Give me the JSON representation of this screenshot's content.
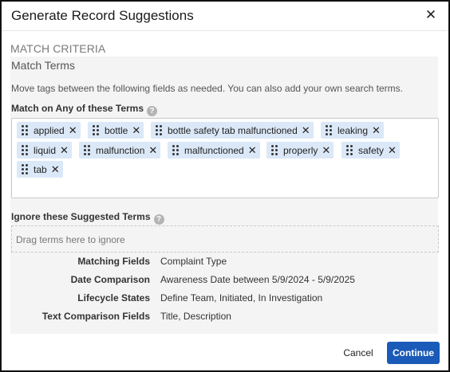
{
  "dialog": {
    "title": "Generate Record Suggestions",
    "close_icon": "close-icon"
  },
  "section": {
    "heading": "MATCH CRITERIA",
    "panel_title": "Match Terms",
    "description": "Move tags between the following fields as needed. You can also add your own search terms."
  },
  "match_terms": {
    "label": "Match on Any of these Terms",
    "help_glyph": "?",
    "tags": [
      "applied",
      "bottle",
      "bottle safety tab malfunctioned",
      "leaking",
      "liquid",
      "malfunction",
      "malfunctioned",
      "properly",
      "safety",
      "tab"
    ],
    "remove_glyph": "✕"
  },
  "ignore_terms": {
    "label": "Ignore these Suggested Terms",
    "help_glyph": "?",
    "placeholder": "Drag terms here to ignore"
  },
  "summary": [
    {
      "label": "Matching Fields",
      "value": "Complaint Type"
    },
    {
      "label": "Date Comparison",
      "value": "Awareness Date between 5/9/2024 - 5/9/2025"
    },
    {
      "label": "Lifecycle States",
      "value": "Define Team, Initiated, In Investigation"
    },
    {
      "label": "Text Comparison Fields",
      "value": "Title, Description"
    }
  ],
  "footer": {
    "cancel_label": "Cancel",
    "continue_label": "Continue"
  },
  "colors": {
    "primary_button": "#1a5ab8",
    "tag_bg": "#dbe8f8",
    "panel_bg": "#f4f4f4"
  }
}
